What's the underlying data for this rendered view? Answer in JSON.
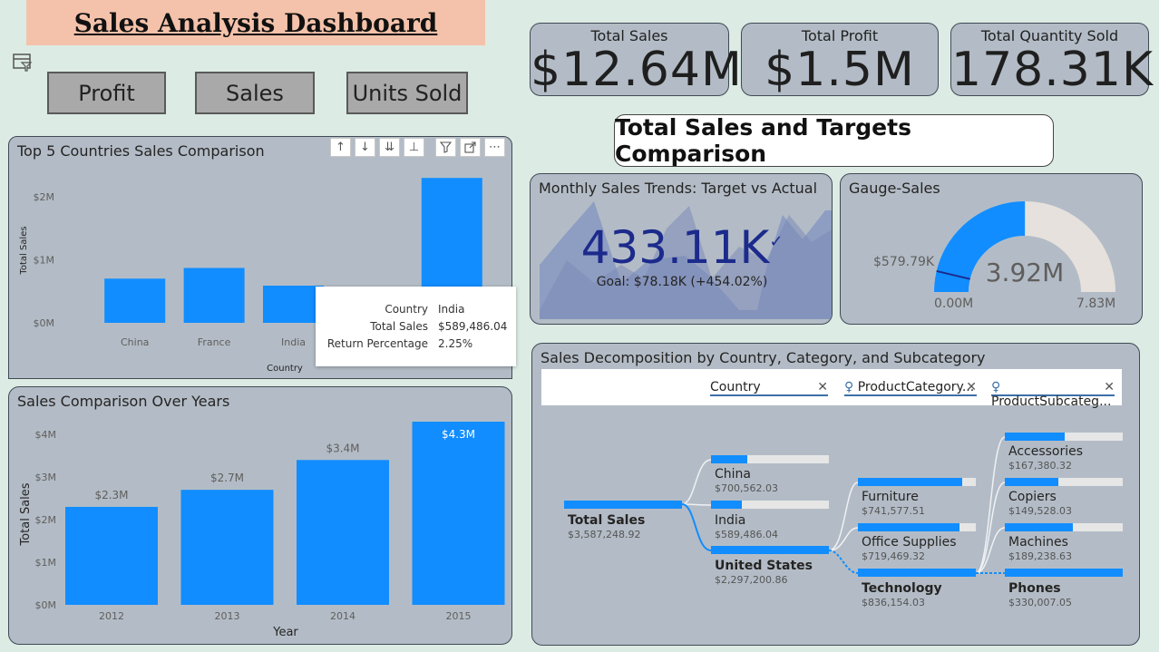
{
  "header": {
    "title": "Sales Analysis Dashboard"
  },
  "buttons": {
    "profit": "Profit",
    "sales": "Sales",
    "units": "Units Sold"
  },
  "kpis": [
    {
      "label": "Total Sales",
      "value": "$12.64M"
    },
    {
      "label": "Total Profit",
      "value": "$1.5M"
    },
    {
      "label": "Total Quantity Sold",
      "value": "178.31K"
    }
  ],
  "target_banner": "Total Sales and Targets Comparison",
  "top5": {
    "title": "Top 5 Countries Sales Comparison",
    "tooltip": [
      {
        "label": "Country",
        "value": "India"
      },
      {
        "label": "Total Sales",
        "value": "$589,486.04"
      },
      {
        "label": "Return Percentage",
        "value": "2.25%"
      }
    ]
  },
  "years_title": "Sales Comparison Over Years",
  "monthly": {
    "title": "Monthly Sales Trends: Target vs Actual",
    "value": "433.11K",
    "goal": "Goal: $78.18K (+454.02%)"
  },
  "gauge": {
    "title": "Gauge-Sales",
    "value": "3.92M",
    "min": "0.00M",
    "max": "7.83M",
    "target_label": "$579.79K",
    "value_num": 3.92,
    "min_num": 0,
    "max_num": 7.83,
    "target_num": 0.58,
    "fill_color": "#118dff",
    "track_color": "#e6e1dc"
  },
  "decomp": {
    "title": "Sales Decomposition by Country, Category, and Subcategory",
    "fields": [
      "Country",
      "ProductCategory...",
      "ProductSubcateg..."
    ],
    "root": {
      "name": "Total Sales",
      "value": "$3,587,248.92"
    },
    "countries": [
      {
        "name": "China",
        "value": "$700,562.03"
      },
      {
        "name": "India",
        "value": "$589,486.04"
      },
      {
        "name": "United States",
        "value": "$2,297,200.86"
      }
    ],
    "categories": [
      {
        "name": "Furniture",
        "value": "$741,577.51"
      },
      {
        "name": "Office Supplies",
        "value": "$719,469.32"
      },
      {
        "name": "Technology",
        "value": "$836,154.03"
      }
    ],
    "subcategories": [
      {
        "name": "Accessories",
        "value": "$167,380.32"
      },
      {
        "name": "Copiers",
        "value": "$149,528.03"
      },
      {
        "name": "Machines",
        "value": "$189,238.63"
      },
      {
        "name": "Phones",
        "value": "$330,007.05"
      }
    ]
  },
  "chart_data": [
    {
      "type": "bar",
      "title": "Top 5 Countries Sales Comparison",
      "xlabel": "Country",
      "ylabel": "Total Sales",
      "categories": [
        "China",
        "France",
        "India",
        "United States"
      ],
      "values": [
        700562.03,
        870000,
        589486.04,
        2297200.86
      ],
      "ylim": [
        0,
        2300000
      ],
      "yticks": [
        {
          "value": 0,
          "label": "$0M"
        },
        {
          "value": 1000000,
          "label": "$1M"
        },
        {
          "value": 2000000,
          "label": "$2M"
        }
      ]
    },
    {
      "type": "bar",
      "title": "Sales Comparison Over Years",
      "xlabel": "Year",
      "ylabel": "Total Sales",
      "categories": [
        "2012",
        "2013",
        "2014",
        "2015"
      ],
      "values": [
        2.3,
        2.7,
        3.4,
        4.3
      ],
      "data_labels": [
        "$2.3M",
        "$2.7M",
        "$3.4M",
        "$4.3M"
      ],
      "ylim": [
        0,
        4.3
      ],
      "yticks": [
        {
          "value": 0,
          "label": "$0M"
        },
        {
          "value": 1,
          "label": "$1M"
        },
        {
          "value": 2,
          "label": "$2M"
        },
        {
          "value": 3,
          "label": "$3M"
        },
        {
          "value": 4,
          "label": "$4M"
        }
      ]
    }
  ]
}
